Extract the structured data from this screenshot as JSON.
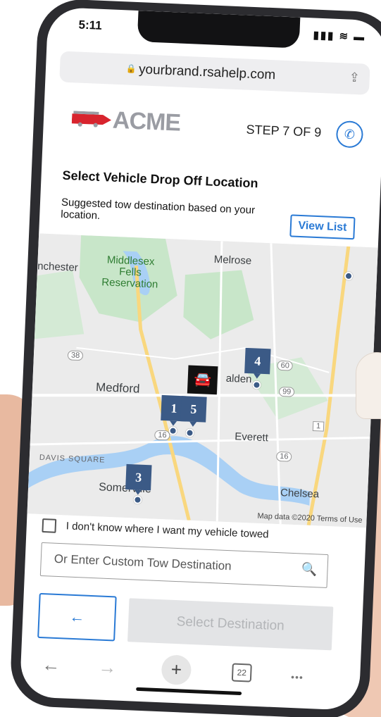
{
  "status_bar": {
    "time": "5:11",
    "icons": "▮▮▮ ≋ ▬"
  },
  "url_bar": {
    "url": "yourbrand.rsahelp.com"
  },
  "brand": {
    "logo_text": "ACME",
    "accent": "#d8242e"
  },
  "header": {
    "step": "STEP 7 OF 9"
  },
  "content": {
    "title": "Select Vehicle Drop Off Location",
    "subtitle": "Suggested tow destination based on your location.",
    "view_list_label": "View List"
  },
  "map": {
    "places": {
      "winchester": "nchester",
      "middlesex": "Middlesex\nFells\nReservation",
      "melrose": "Melrose",
      "malden": "alden",
      "medford": "Medford",
      "everett": "Everett",
      "davis_square": "DAVIS SQUARE",
      "somerville": "Somerville",
      "chelsea": "Chelsea"
    },
    "routes": [
      "38",
      "60",
      "99",
      "1",
      "16",
      "16",
      "16"
    ],
    "pins": [
      {
        "label": "4"
      },
      {
        "label": "1"
      },
      {
        "label": "5"
      },
      {
        "label": "3"
      }
    ],
    "attribution": "Map data ©2020   Terms of Use",
    "colors": {
      "water": "#a9d0f5",
      "park": "#c8e6c9",
      "highway": "#f9d77e",
      "pin": "#3b5a86"
    }
  },
  "form": {
    "unknown_label": "I don't know where I want my vehicle towed",
    "custom_placeholder": "Or Enter Custom Tow Destination",
    "select_label": "Select Destination",
    "back_glyph": "←"
  },
  "browser": {
    "back": "←",
    "forward": "→",
    "new_tab": "+",
    "tabs": "22",
    "more": "•••"
  }
}
